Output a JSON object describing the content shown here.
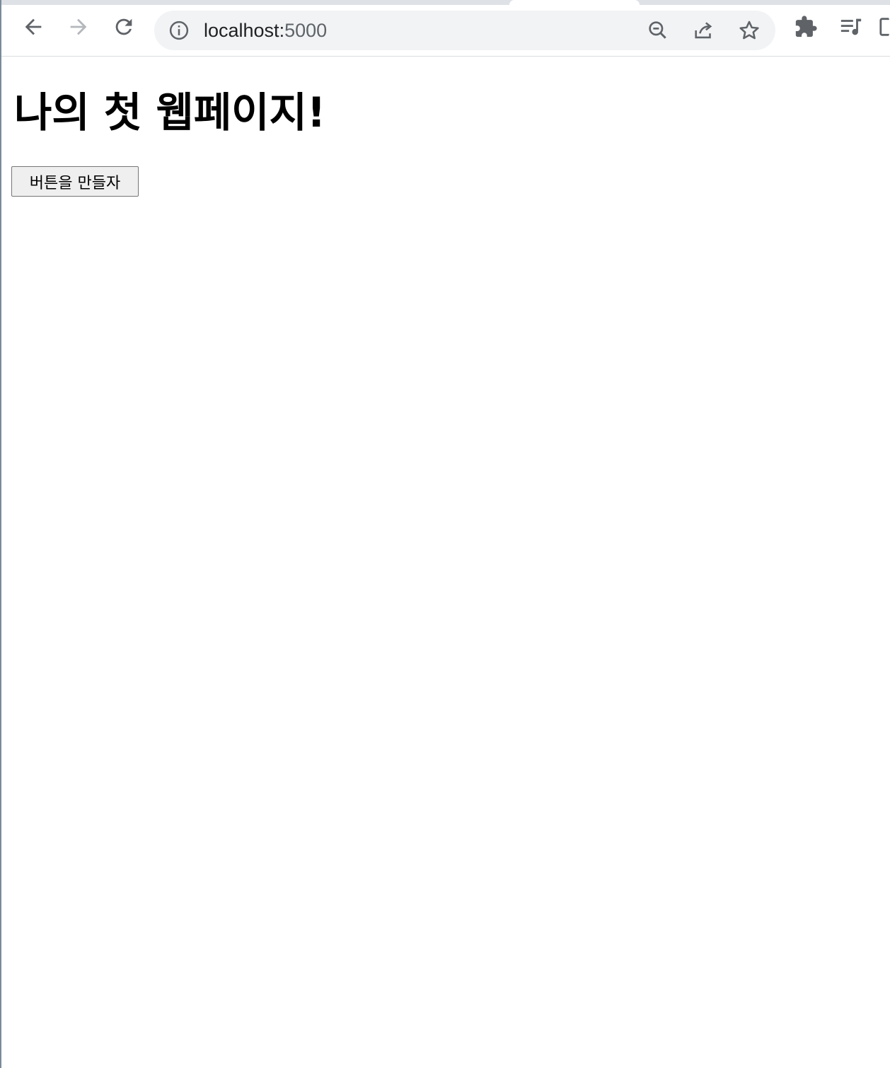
{
  "browser": {
    "address_bar": {
      "host": "localhost:",
      "port": "5000"
    },
    "toolbar_icons": [
      "back-arrow-icon",
      "forward-arrow-icon",
      "reload-icon",
      "site-info-icon",
      "zoom-out-icon",
      "share-icon",
      "bookmark-star-icon",
      "extensions-puzzle-icon",
      "media-playlist-icon",
      "side-panel-icon"
    ],
    "colors": {
      "tabstrip": "#dee1e6",
      "omnibox": "#f1f3f4",
      "icon": "#5f6368",
      "icon_disabled": "#b4b7bb"
    }
  },
  "page": {
    "heading": "나의 첫 웹페이지!",
    "button_label": "버튼을 만들자"
  }
}
